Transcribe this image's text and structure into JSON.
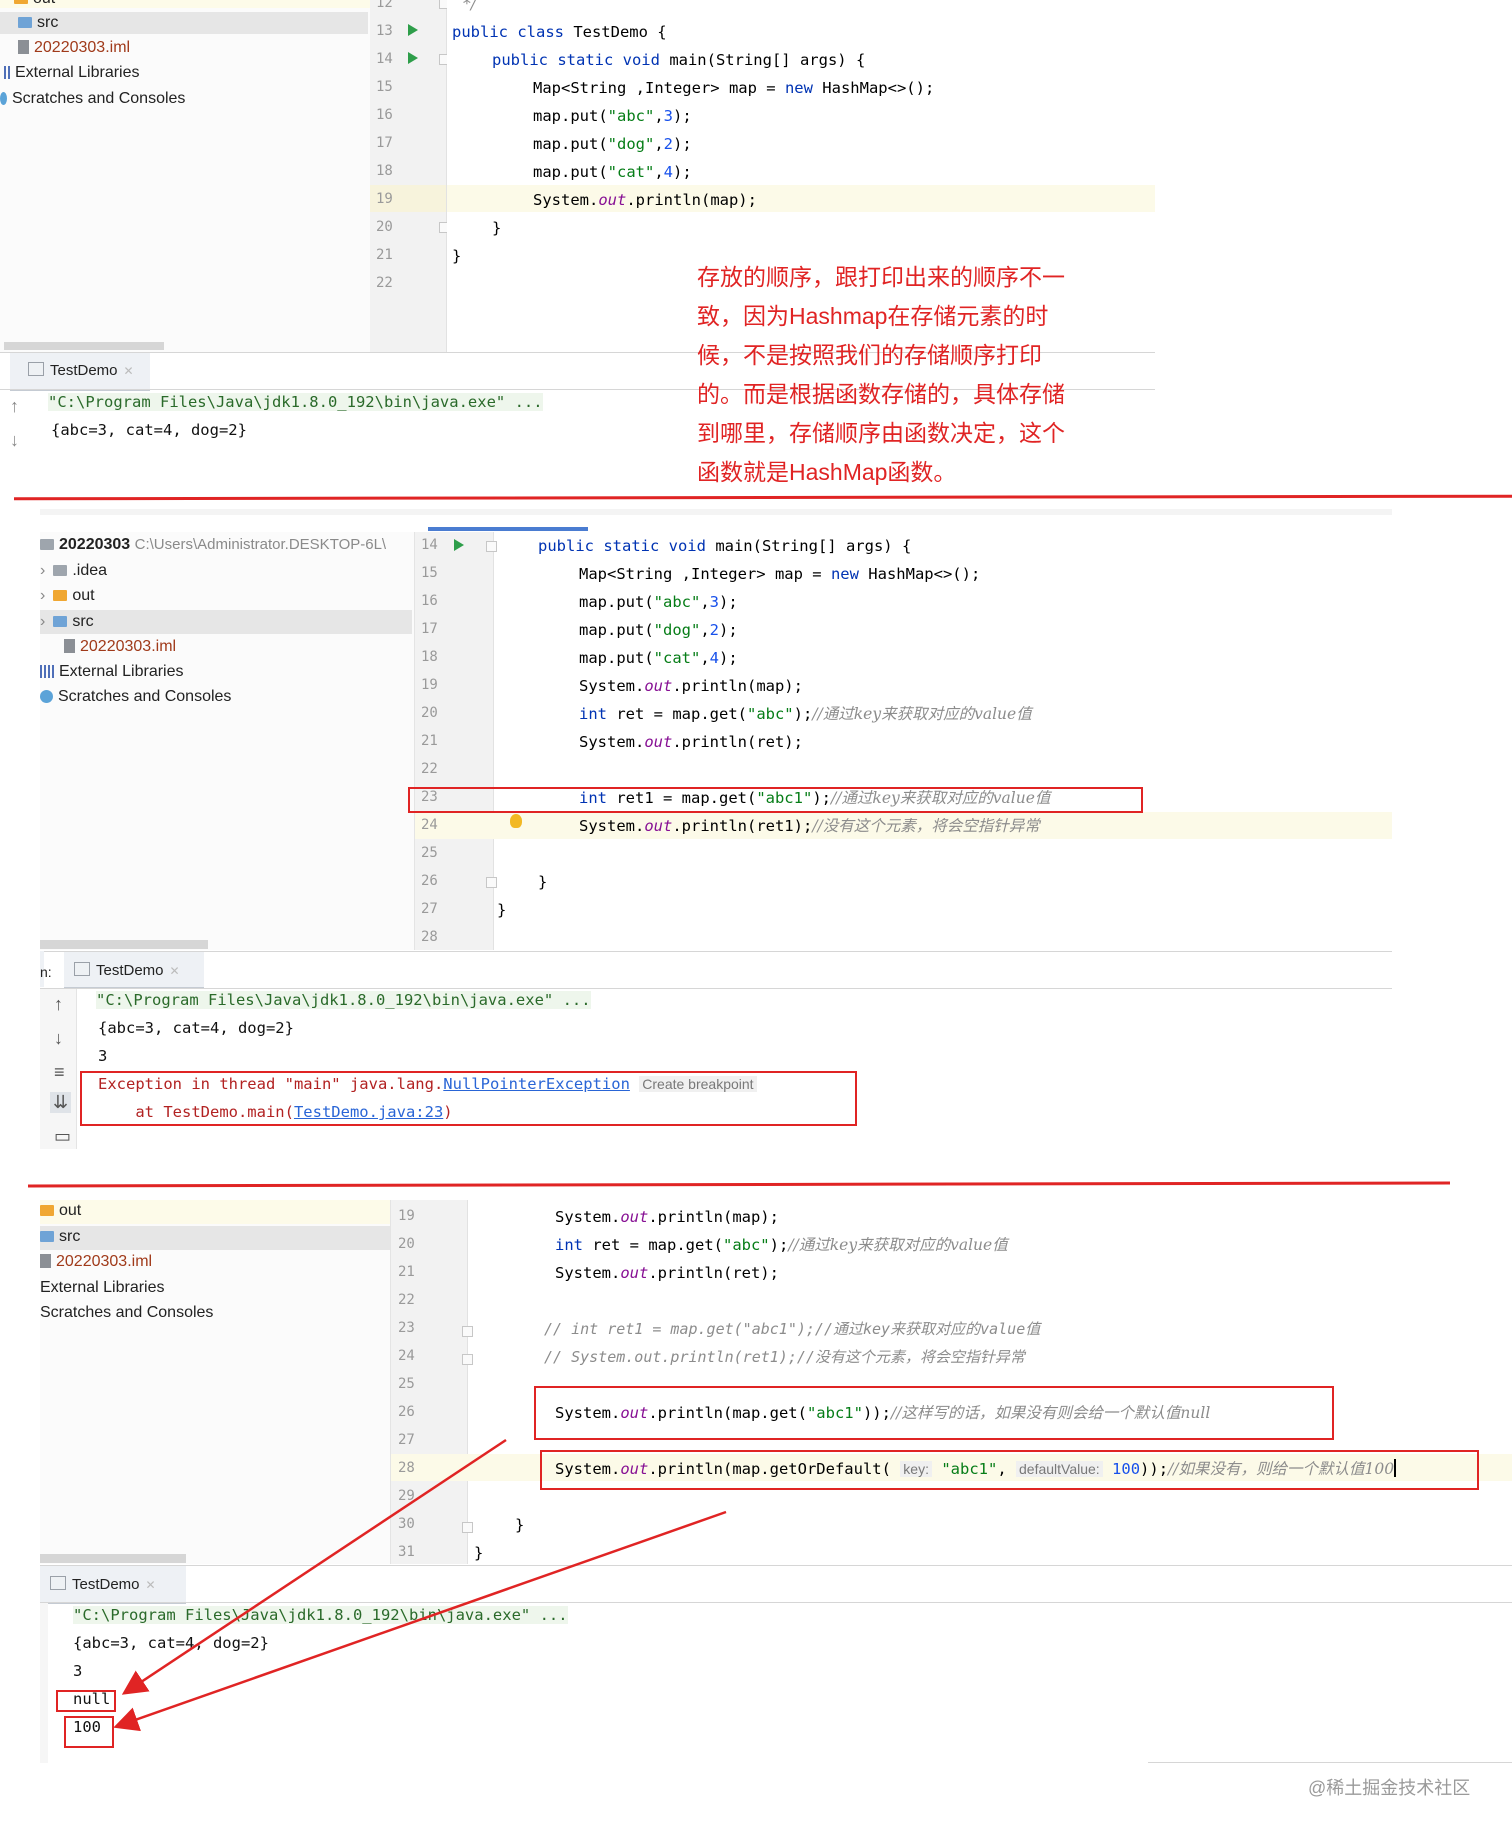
{
  "panel1": {
    "tree": [
      {
        "label": "out",
        "icon": "folder-orange"
      },
      {
        "label": "src",
        "icon": "folder-blue"
      },
      {
        "label": "20220303.iml",
        "icon": "iml-file"
      },
      {
        "label": "External Libraries",
        "icon": "library"
      },
      {
        "label": "Scratches and Consoles",
        "icon": "scratches"
      }
    ],
    "line_numbers": [
      "12",
      "13",
      "14",
      "15",
      "16",
      "17",
      "18",
      "19",
      "20",
      "21",
      "22"
    ],
    "code": {
      "l12": "*/",
      "l13_kw": "public class",
      "l13_rest": " TestDemo {",
      "l14_kw": "public static void",
      "l14_rest": " main(String[] args) {",
      "l15_a": "Map<String ,Integer> map = ",
      "l15_kw": "new",
      "l15_b": " HashMap<>();",
      "l16_a": "map.put(",
      "l16_s": "\"abc\"",
      "l16_n": "3",
      "l17_s": "\"dog\"",
      "l17_n": "2",
      "l18_s": "\"cat\"",
      "l18_n": "4",
      "l19_a": "System.",
      "l19_f": "out",
      "l19_b": ".println(map);",
      "l20": "}",
      "l21": "}"
    },
    "run_tab": "TestDemo",
    "console": [
      "\"C:\\Program Files\\Java\\jdk1.8.0_192\\bin\\java.exe\" ...",
      "{abc=3, cat=4, dog=2}"
    ],
    "note": [
      "存放的顺序，跟打印出来的顺序不一",
      "致，因为Hashmap在存储元素的时",
      "候，不是按照我们的存储顺序打印",
      "的。而是根据函数存储的，具体存储",
      "到哪里，存储顺序由函数决定，这个",
      "函数就是HashMap函数。"
    ]
  },
  "panel2": {
    "project_name": "20220303",
    "project_path": "C:\\Users\\Administrator.DESKTOP-6L\\",
    "tree": [
      {
        "label": ".idea",
        "icon": "folder-gray"
      },
      {
        "label": "out",
        "icon": "folder-orange"
      },
      {
        "label": "src",
        "icon": "folder-blue"
      },
      {
        "label": "20220303.iml",
        "icon": "iml-file"
      },
      {
        "label": "External Libraries",
        "icon": "library"
      },
      {
        "label": "Scratches and Consoles",
        "icon": "scratches"
      }
    ],
    "line_numbers": [
      "14",
      "15",
      "16",
      "17",
      "18",
      "19",
      "20",
      "21",
      "22",
      "23",
      "24",
      "25",
      "26",
      "27",
      "28"
    ],
    "code": {
      "l14_kw": "public static void",
      "l14_rest": " main(String[] args) {",
      "l15_a": "Map<String ,Integer> map = ",
      "l15_kw": "new",
      "l15_b": " HashMap<>();",
      "put": "map.put(",
      "l16_s": "\"abc\"",
      "l16_n": "3",
      "l17_s": "\"dog\"",
      "l17_n": "2",
      "l18_s": "\"cat\"",
      "l18_n": "4",
      "sys": "System.",
      "out": "out",
      "println_map": ".println(map);",
      "int": "int",
      "l20_a": " ret = map.get(",
      "l20_s": "\"abc\"",
      "l20_b": ");",
      "l20_c": "//通过key来获取对应的value值",
      "println_ret": ".println(ret);",
      "l23_a": " ret1 = map.get(",
      "l23_s": "\"abc1\"",
      "l23_b": ");",
      "l23_c": "//通过key来获取对应的value值",
      "println_ret1": ".println(ret1);",
      "l24_c": "//没有这个元素，将会空指针异常",
      "close": "}"
    },
    "run_tab": "TestDemo",
    "console": {
      "cmd": "\"C:\\Program Files\\Java\\jdk1.8.0_192\\bin\\java.exe\" ...",
      "map": "{abc=3, cat=4, dog=2}",
      "ret": "3",
      "exc_a": "Exception in thread \"main\" java.lang.",
      "exc_link": "NullPointerException",
      "exc_hint": "Create breakpoint",
      "at_a": "    at TestDemo.main(",
      "at_link": "TestDemo.java:23",
      "at_b": ")"
    }
  },
  "panel3": {
    "tree": [
      {
        "label": "out",
        "icon": "folder-orange"
      },
      {
        "label": "src",
        "icon": "folder-blue"
      },
      {
        "label": "20220303.iml",
        "icon": "iml-file"
      },
      {
        "label": "External Libraries",
        "icon": "none"
      },
      {
        "label": "Scratches and Consoles",
        "icon": "none"
      }
    ],
    "line_numbers": [
      "19",
      "20",
      "21",
      "22",
      "23",
      "24",
      "25",
      "26",
      "27",
      "28",
      "29",
      "30",
      "31"
    ],
    "code": {
      "sys": "System.",
      "out": "out",
      "println_map": ".println(map);",
      "int": "int",
      "l20_a": " ret = map.get(",
      "l20_s": "\"abc\"",
      "l20_b": ");",
      "l20_c": "//通过key来获取对应的value值",
      "println_ret": ".println(ret);",
      "l23": "// int ret1 = map.get(\"abc1\");//通过key来获取对应的value值",
      "l24": "// System.out.println(ret1);//没有这个元素，将会空指针异常",
      "l26_a": ".println(map.get(",
      "l26_s": "\"abc1\"",
      "l26_b": "));",
      "l26_c": "//这样写的话，如果没有则会给一个默认值null",
      "l28_a": ".println(map.getOrDefault( ",
      "hint_key": "key:",
      "l28_s": "\"abc1\"",
      "hint_default": "defaultValue:",
      "l28_n": "100",
      "l28_b": "));",
      "l28_c": "//如果没有，则给一个默认值100",
      "close": "}"
    },
    "run_tab": "TestDemo",
    "console": [
      "\"C:\\Program Files\\Java\\jdk1.8.0_192\\bin\\java.exe\" ...",
      "{abc=3, cat=4, dog=2}",
      "3",
      "null",
      "100"
    ]
  },
  "watermark": "@稀土掘金技术社区",
  "colors": {
    "annotation_red": "#e02424",
    "keyword": "#0033b3",
    "string": "#067d17",
    "number": "#1750eb",
    "field": "#871094"
  }
}
